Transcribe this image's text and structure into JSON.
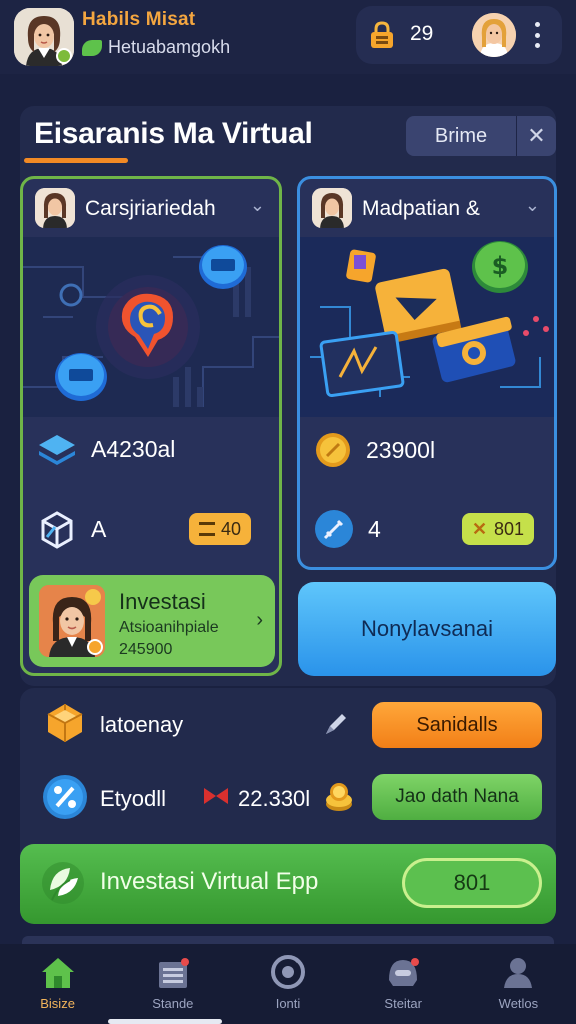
{
  "header": {
    "name": "Habils Misat",
    "subtitle": "Hetuabamgokh",
    "count": "29",
    "menu_icon": "kebab-menu-icon"
  },
  "panel": {
    "title": "Eisaranis Ma Virtual",
    "filter_label": "Brime",
    "close_label": "✕"
  },
  "cards": [
    {
      "name": "Carsjriariedah",
      "stat_value": "A4230al",
      "level": "A",
      "pill_value": "40",
      "accent": "#6fb548"
    },
    {
      "name": "Madpatian &",
      "stat_value": "23900l",
      "level": "4",
      "pill_value": "801",
      "accent": "#3b8fe0"
    }
  ],
  "invest": {
    "title": "Investasi",
    "subtitle": "Atsioanihpiale",
    "number": "245900"
  },
  "blue_button": {
    "label": "Nonylavsanai"
  },
  "lower": {
    "row1_label": "latoenay",
    "row1_button": "Sanidalls",
    "row2_label": "Etyodll",
    "row2_value": "22.330l",
    "row2_button": "Jao dath Nana"
  },
  "banner": {
    "text": "Investasi Virtual Epp",
    "pill": "801"
  },
  "nav": [
    {
      "label": "Bisize",
      "icon": "home-icon",
      "active": true
    },
    {
      "label": "Stande",
      "icon": "store-icon",
      "active": false
    },
    {
      "label": "Ionti",
      "icon": "target-icon",
      "active": false
    },
    {
      "label": "Steitar",
      "icon": "helmet-icon",
      "active": false
    },
    {
      "label": "Wetlos",
      "icon": "profile-icon",
      "active": false
    }
  ]
}
